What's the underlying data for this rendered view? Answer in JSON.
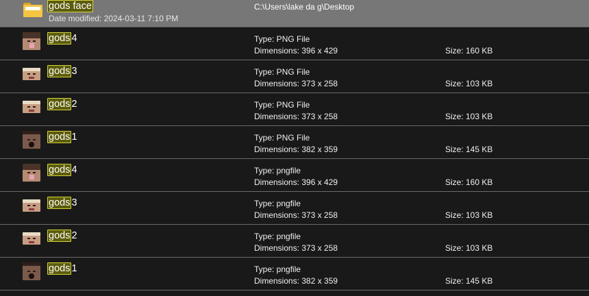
{
  "folder": {
    "highlight": "gods face",
    "date_modified": "Date modified: 2024-03-11 7:10 PM",
    "path": "C:\\Users\\lake da g\\Desktop"
  },
  "results": [
    {
      "highlight": "gods",
      "suffix": "4",
      "type": "Type: PNG File",
      "dimensions": "Dimensions: 396 x 429",
      "size": "Size: 160 KB",
      "thumb_icon": "face-tongue-thumbnail"
    },
    {
      "highlight": "gods",
      "suffix": "3",
      "type": "Type: PNG File",
      "dimensions": "Dimensions: 373 x 258",
      "size": "Size: 103 KB",
      "thumb_icon": "face-squint-thumbnail"
    },
    {
      "highlight": "gods",
      "suffix": "2",
      "type": "Type: PNG File",
      "dimensions": "Dimensions: 373 x 258",
      "size": "Size: 103 KB",
      "thumb_icon": "face-squint-thumbnail"
    },
    {
      "highlight": "gods",
      "suffix": "1",
      "type": "Type: PNG File",
      "dimensions": "Dimensions: 382 x 359",
      "size": "Size: 145 KB",
      "thumb_icon": "face-dark-thumbnail"
    },
    {
      "highlight": "gods",
      "suffix": "4",
      "type": "Type: pngfile",
      "dimensions": "Dimensions: 396 x 429",
      "size": "Size: 160 KB",
      "thumb_icon": "face-tongue-thumbnail"
    },
    {
      "highlight": "gods",
      "suffix": "3",
      "type": "Type: pngfile",
      "dimensions": "Dimensions: 373 x 258",
      "size": "Size: 103 KB",
      "thumb_icon": "face-squint-thumbnail"
    },
    {
      "highlight": "gods",
      "suffix": "2",
      "type": "Type: pngfile",
      "dimensions": "Dimensions: 373 x 258",
      "size": "Size: 103 KB",
      "thumb_icon": "face-squint-thumbnail"
    },
    {
      "highlight": "gods",
      "suffix": "1",
      "type": "Type: pngfile",
      "dimensions": "Dimensions: 382 x 359",
      "size": "Size: 145 KB",
      "thumb_icon": "face-dark-thumbnail"
    }
  ],
  "colors": {
    "selected_row": "#777777",
    "background": "#191919",
    "highlight_fill": "#5c5c0d",
    "highlight_border": "#d4d43a"
  }
}
